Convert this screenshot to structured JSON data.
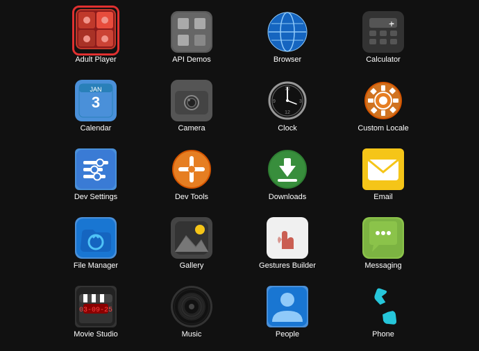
{
  "apps": [
    {
      "id": "adult-player",
      "label": "Adult Player",
      "highlighted": true
    },
    {
      "id": "api-demos",
      "label": "API Demos"
    },
    {
      "id": "browser",
      "label": "Browser"
    },
    {
      "id": "calculator",
      "label": "Calculator"
    },
    {
      "id": "calendar",
      "label": "Calendar"
    },
    {
      "id": "camera",
      "label": "Camera"
    },
    {
      "id": "clock",
      "label": "Clock"
    },
    {
      "id": "custom-locale",
      "label": "Custom Locale"
    },
    {
      "id": "dev-settings",
      "label": "Dev Settings"
    },
    {
      "id": "dev-tools",
      "label": "Dev Tools"
    },
    {
      "id": "downloads",
      "label": "Downloads"
    },
    {
      "id": "email",
      "label": "Email"
    },
    {
      "id": "file-manager",
      "label": "File Manager"
    },
    {
      "id": "gallery",
      "label": "Gallery"
    },
    {
      "id": "gestures-builder",
      "label": "Gestures Builder"
    },
    {
      "id": "messaging",
      "label": "Messaging"
    },
    {
      "id": "movie-studio",
      "label": "Movie Studio"
    },
    {
      "id": "music",
      "label": "Music"
    },
    {
      "id": "people",
      "label": "People"
    },
    {
      "id": "phone",
      "label": "Phone"
    }
  ]
}
